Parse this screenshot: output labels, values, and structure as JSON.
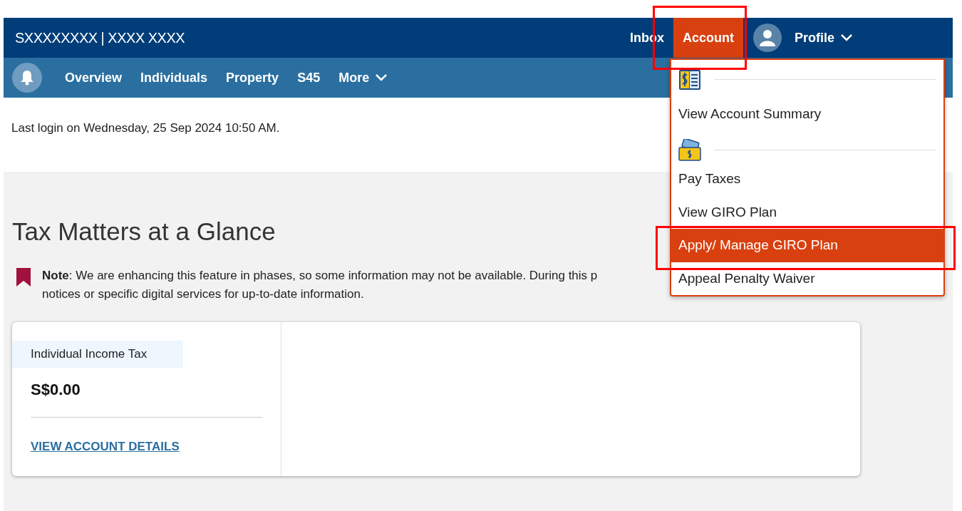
{
  "top_bar": {
    "user": "SXXXXXXXX | XXXX XXXX",
    "links": [
      {
        "label": "Inbox",
        "selected": false
      },
      {
        "label": "Account",
        "selected": true
      }
    ],
    "profile": "Profile"
  },
  "nav": {
    "items": [
      "Overview",
      "Individuals",
      "Property",
      "S45"
    ],
    "more": "More"
  },
  "account_menu": [
    {
      "kind": "section"
    },
    {
      "kind": "item",
      "label": "View Account Summary",
      "selected": false
    },
    {
      "kind": "section"
    },
    {
      "kind": "item",
      "label": "Pay Taxes",
      "selected": false
    },
    {
      "kind": "item",
      "label": "View GIRO Plan",
      "selected": false
    },
    {
      "kind": "item",
      "label": "Apply/ Manage GIRO Plan",
      "selected": true
    },
    {
      "kind": "item",
      "label": "Appeal Penalty Waiver",
      "selected": false
    }
  ],
  "last_login": "Last login on Wednesday, 25 Sep 2024 10:50 AM.",
  "heading": "Tax Matters at a Glance",
  "note": [
    "**Note**: We are enhancing this feature in phases, so some information may not be available. During this p",
    "notices or specific digital services for up-to-date information."
  ],
  "card": {
    "tag": "Individual Income Tax",
    "amount": "S$0.00",
    "link": "VIEW ACCOUNT DETAILS"
  }
}
